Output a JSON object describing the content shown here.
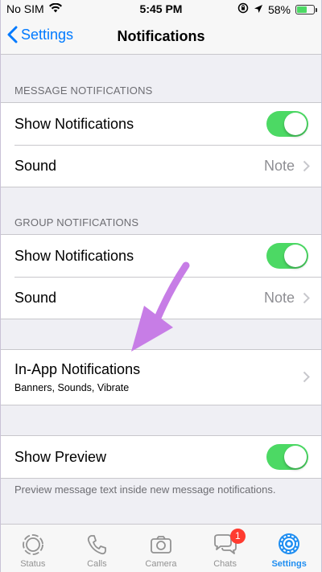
{
  "status_bar": {
    "carrier": "No SIM",
    "time": "5:45 PM",
    "battery_percent": "58%",
    "battery_level": 0.58
  },
  "nav": {
    "back_label": "Settings",
    "title": "Notifications"
  },
  "message_notifications": {
    "header": "MESSAGE NOTIFICATIONS",
    "show_label": "Show Notifications",
    "show_on": true,
    "sound_label": "Sound",
    "sound_value": "Note"
  },
  "group_notifications": {
    "header": "GROUP NOTIFICATIONS",
    "show_label": "Show Notifications",
    "show_on": true,
    "sound_label": "Sound",
    "sound_value": "Note"
  },
  "in_app": {
    "title": "In-App Notifications",
    "subtitle": "Banners, Sounds, Vibrate"
  },
  "preview": {
    "label": "Show Preview",
    "on": true,
    "note": "Preview message text inside new message notifications."
  },
  "tabs": [
    {
      "label": "Status",
      "icon": "status-icon"
    },
    {
      "label": "Calls",
      "icon": "phone-icon"
    },
    {
      "label": "Camera",
      "icon": "camera-icon"
    },
    {
      "label": "Chats",
      "icon": "chat-bubbles-icon",
      "badge": "1"
    },
    {
      "label": "Settings",
      "icon": "gear-icon",
      "active": true
    }
  ],
  "colors": {
    "accent": "#007aff",
    "toggle_on": "#4cd964",
    "arrow": "#c77de6",
    "badge": "#ff3b30"
  }
}
